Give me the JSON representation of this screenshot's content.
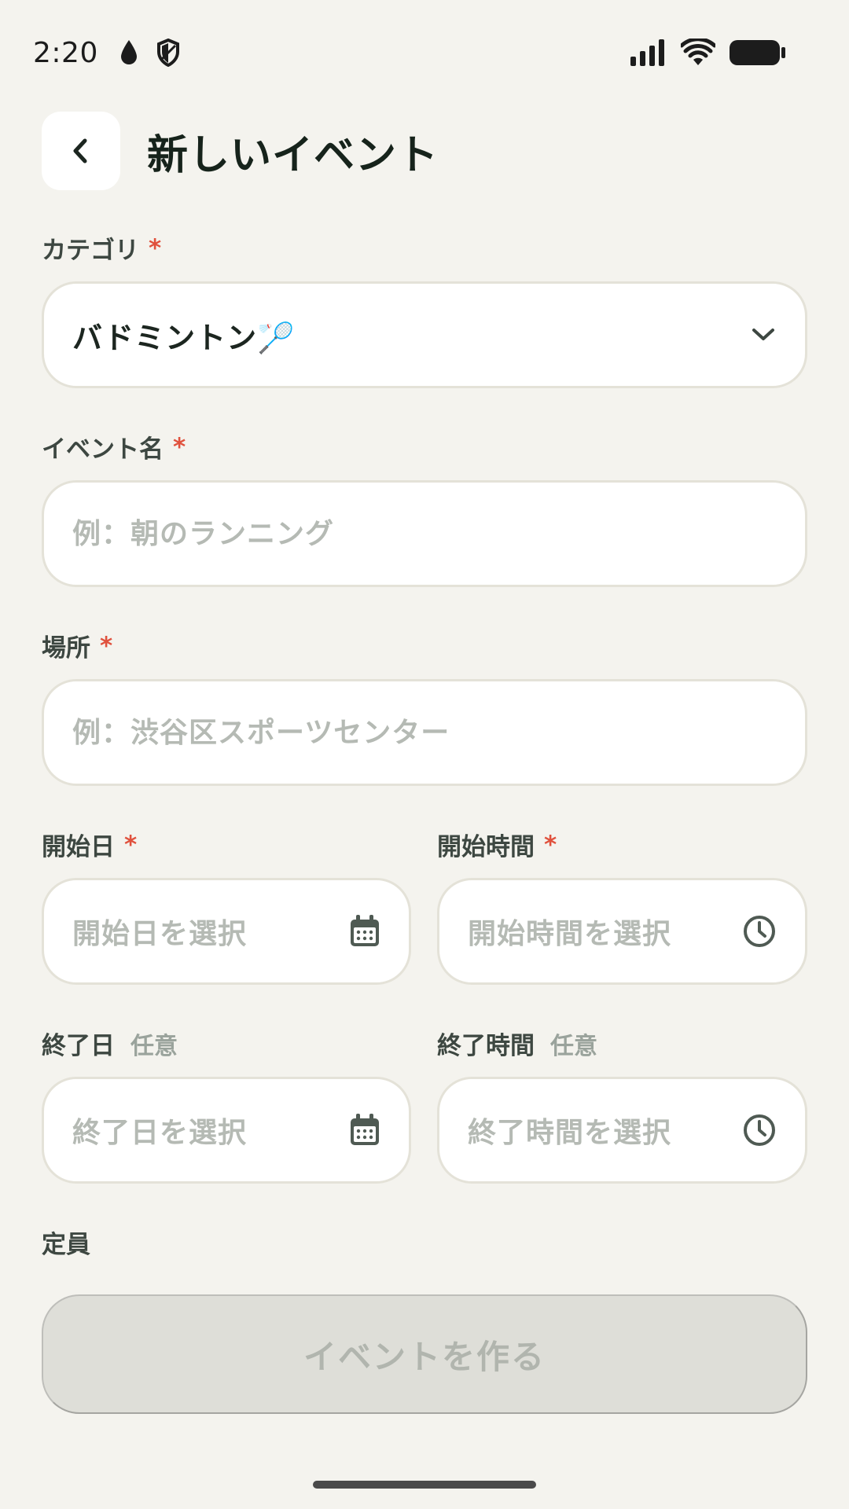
{
  "status_bar": {
    "time": "2:20"
  },
  "header": {
    "title": "新しいイベント"
  },
  "category": {
    "label": "カテゴリ",
    "required_mark": "*",
    "value": "バドミントン🏸"
  },
  "event_name": {
    "label": "イベント名",
    "required_mark": "*",
    "placeholder": "例：朝のランニング"
  },
  "location": {
    "label": "場所",
    "required_mark": "*",
    "placeholder": "例：渋谷区スポーツセンター"
  },
  "start_date": {
    "label": "開始日",
    "required_mark": "*",
    "placeholder": "開始日を選択"
  },
  "start_time": {
    "label": "開始時間",
    "required_mark": "*",
    "placeholder": "開始時間を選択"
  },
  "end_date": {
    "label": "終了日",
    "optional": "任意",
    "placeholder": "終了日を選択"
  },
  "end_time": {
    "label": "終了時間",
    "optional": "任意",
    "placeholder": "終了時間を選択"
  },
  "capacity": {
    "label": "定員"
  },
  "submit": {
    "label": "イベントを作る"
  },
  "colors": {
    "background": "#f4f3ee",
    "required": "#e0513d",
    "placeholder": "#b5bab4",
    "disabled_button": "#deded8"
  }
}
